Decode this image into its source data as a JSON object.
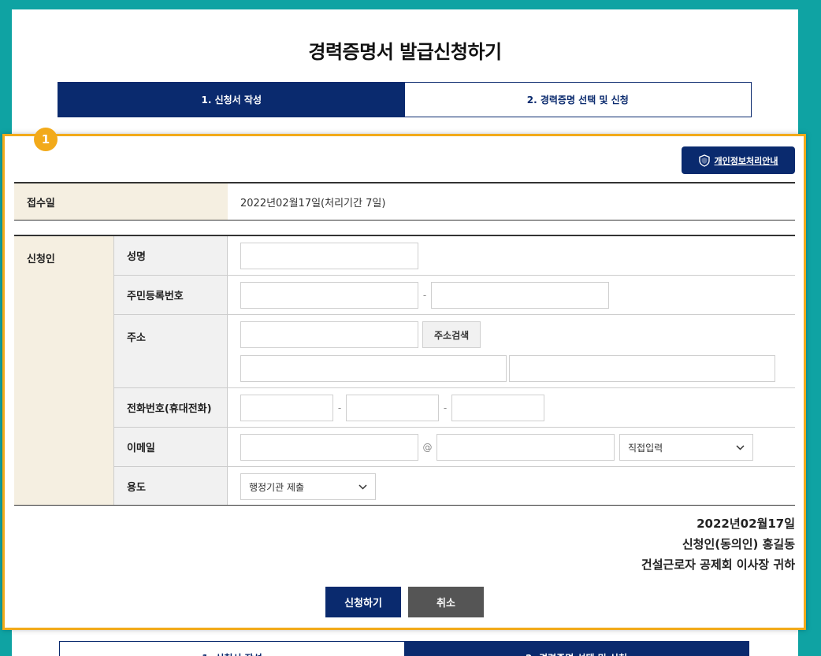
{
  "page_title": "경력증명서 발급신청하기",
  "steps": [
    {
      "label": "1. 신청서 작성",
      "active": true
    },
    {
      "label": "2. 경력증명 선택 및 신청",
      "active": false
    }
  ],
  "badge": "1",
  "privacy_button": {
    "label": "개인정보처리안내",
    "icon": "shield-icon"
  },
  "received": {
    "label": "접수일",
    "value": "2022년02월17일(처리기간 7일)"
  },
  "applicant": {
    "label": "신청인",
    "fields": {
      "name": {
        "label": "성명",
        "value": ""
      },
      "resident_number": {
        "label": "주민등록번호",
        "separator": "-"
      },
      "address": {
        "label": "주소",
        "search_button": "주소검색"
      },
      "phone": {
        "label": "전화번호(휴대전화)",
        "separator": "-"
      },
      "email": {
        "label": "이메일",
        "at": "@",
        "domain_select": "직접입력"
      },
      "purpose": {
        "label": "용도",
        "select": "행정기관 제출"
      }
    }
  },
  "signature": {
    "date": "2022년02월17일",
    "applicant": "신청인(동의인) 홍길동",
    "recipient": "건설근로자 공제회 이사장 귀하"
  },
  "actions": {
    "submit": "신청하기",
    "cancel": "취소"
  },
  "colors": {
    "background": "#0fa3a3",
    "primary": "#0a2a6e",
    "highlight": "#f2aa1a",
    "label_bg": "#f5efe1"
  }
}
